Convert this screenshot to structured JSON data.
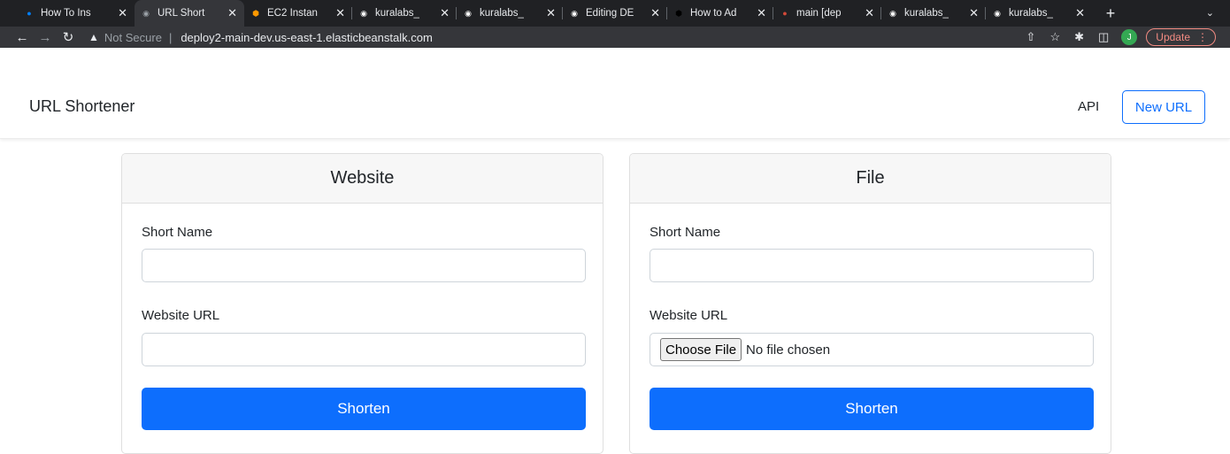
{
  "browser": {
    "tabs": [
      {
        "title": "How To Ins",
        "favicon": "digitalocean-icon",
        "color": "#0080ff"
      },
      {
        "title": "URL Short",
        "favicon": "globe-icon",
        "color": "#9aa0a6",
        "active": true
      },
      {
        "title": "EC2 Instan",
        "favicon": "aws-icon",
        "color": "#ff9900"
      },
      {
        "title": "kuralabs_",
        "favicon": "github-icon",
        "color": "#ffffff"
      },
      {
        "title": "kuralabs_",
        "favicon": "github-icon",
        "color": "#ffffff"
      },
      {
        "title": "Editing DE",
        "favicon": "github-icon",
        "color": "#ffffff"
      },
      {
        "title": "How to Ad",
        "favicon": "hexagon-icon",
        "color": "#000000"
      },
      {
        "title": "main [dep",
        "favicon": "jenkins-icon",
        "color": "#d24939"
      },
      {
        "title": "kuralabs_",
        "favicon": "github-icon",
        "color": "#ffffff"
      },
      {
        "title": "kuralabs_",
        "favicon": "github-icon",
        "color": "#ffffff"
      }
    ],
    "security_label": "Not Secure",
    "url": "deploy2-main-dev.us-east-1.elasticbeanstalk.com",
    "avatar_letter": "J",
    "update_label": "Update"
  },
  "app": {
    "brand": "URL Shortener",
    "api_link": "API",
    "new_url_button": "New URL"
  },
  "website_card": {
    "title": "Website",
    "short_name_label": "Short Name",
    "website_url_label": "Website URL",
    "submit_label": "Shorten"
  },
  "file_card": {
    "title": "File",
    "short_name_label": "Short Name",
    "website_url_label": "Website URL",
    "choose_file_label": "Choose File",
    "no_file_text": "No file chosen",
    "submit_label": "Shorten"
  }
}
